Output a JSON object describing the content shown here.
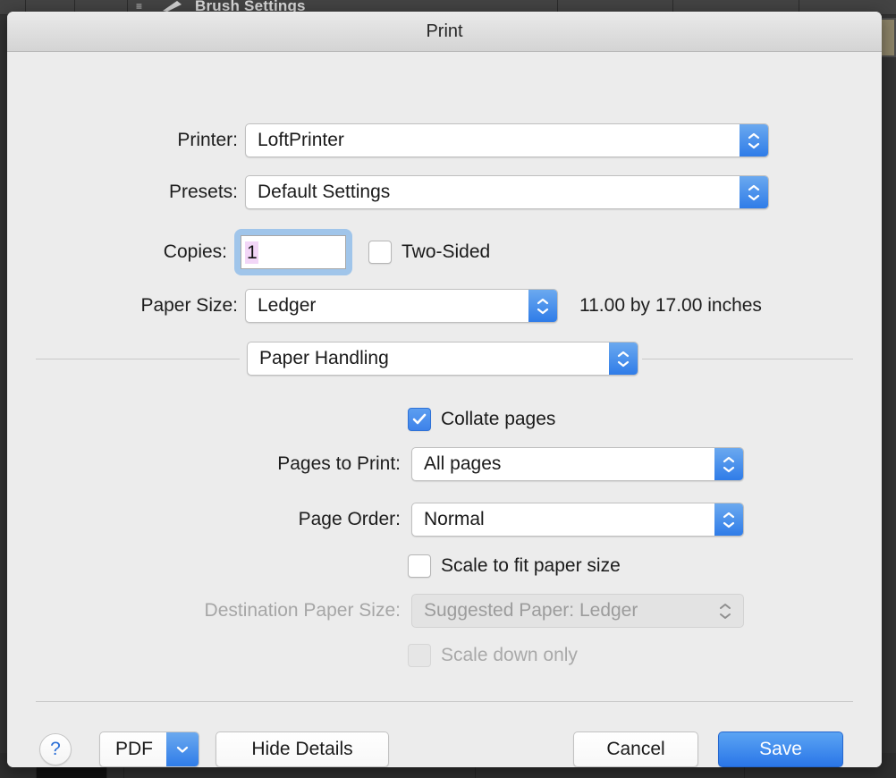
{
  "background": {
    "app_title": "Brush Settings",
    "list_icon": "list-icon",
    "brush_icon": "brush-icon"
  },
  "dialog": {
    "title": "Print"
  },
  "form": {
    "printer": {
      "label": "Printer:",
      "value": "LoftPrinter"
    },
    "presets": {
      "label": "Presets:",
      "value": "Default Settings"
    },
    "copies": {
      "label": "Copies:",
      "value": "1"
    },
    "two_sided": {
      "label": "Two-Sided",
      "checked": false
    },
    "paper_size": {
      "label": "Paper Size:",
      "value": "Ledger",
      "dimensions": "11.00 by 17.00 inches"
    },
    "pane_selector": {
      "value": "Paper Handling"
    },
    "collate": {
      "label": "Collate pages",
      "checked": true
    },
    "pages_to_print": {
      "label": "Pages to Print:",
      "value": "All pages"
    },
    "page_order": {
      "label": "Page Order:",
      "value": "Normal"
    },
    "scale_to_fit": {
      "label": "Scale to fit paper size",
      "checked": false
    },
    "destination_paper_size": {
      "label": "Destination Paper Size:",
      "value": "Suggested Paper: Ledger",
      "disabled": true
    },
    "scale_down_only": {
      "label": "Scale down only",
      "checked": false,
      "disabled": true
    }
  },
  "footer": {
    "help_label": "?",
    "pdf_label": "PDF",
    "hide_details_label": "Hide Details",
    "cancel_label": "Cancel",
    "save_label": "Save"
  },
  "colors": {
    "accent_blue": "#2f7ce8",
    "primary_button": "#3d82ea",
    "focus_ring": "#a0c5ea",
    "selection_highlight": "#f2d6f7",
    "dialog_background": "#ececec",
    "titlebar_top": "#eaeaea",
    "titlebar_bottom": "#d4d4d4"
  }
}
